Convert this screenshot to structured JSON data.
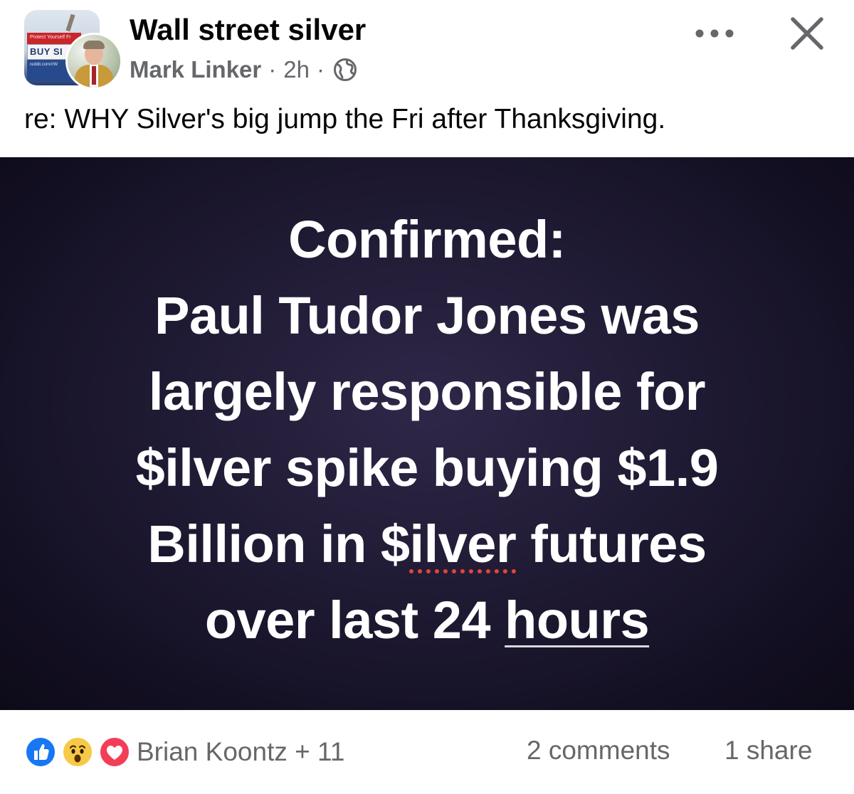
{
  "header": {
    "group_name": "Wall street silver",
    "author": "Mark Linker",
    "separator": "·",
    "time": "2h",
    "privacy_icon": "globe-icon",
    "more_icon": "more-options-icon",
    "close_icon": "close-icon",
    "group_avatar": {
      "tag_small": "Protect Yourself Fr",
      "tag_big": "BUY SI",
      "tag_url": "reddit.com/r/W"
    }
  },
  "caption": "re: WHY Silver's big jump the Fri after Thanksgiving.",
  "image": {
    "lines": [
      "Confirmed:",
      "Paul Tudor Jones was",
      "largely responsible for",
      "$ilver spike buying $1.9"
    ],
    "line5_prefix": "Billion in $",
    "line5_misspelled": "ilver",
    "line5_suffix": " futures",
    "line6_prefix": "over last 24 ",
    "line6_link": "hours"
  },
  "footer": {
    "reaction_icons": [
      "like-icon",
      "wow-icon",
      "love-icon"
    ],
    "reactors": "Brian Koontz + 11",
    "comments": "2 comments",
    "shares": "1 share"
  },
  "colors": {
    "text_primary": "#050505",
    "text_secondary": "#65676b",
    "like_blue": "#1877f2",
    "love_red": "#f33e58",
    "wow_yellow": "#f7c948",
    "image_bg": "#1f1a33"
  }
}
